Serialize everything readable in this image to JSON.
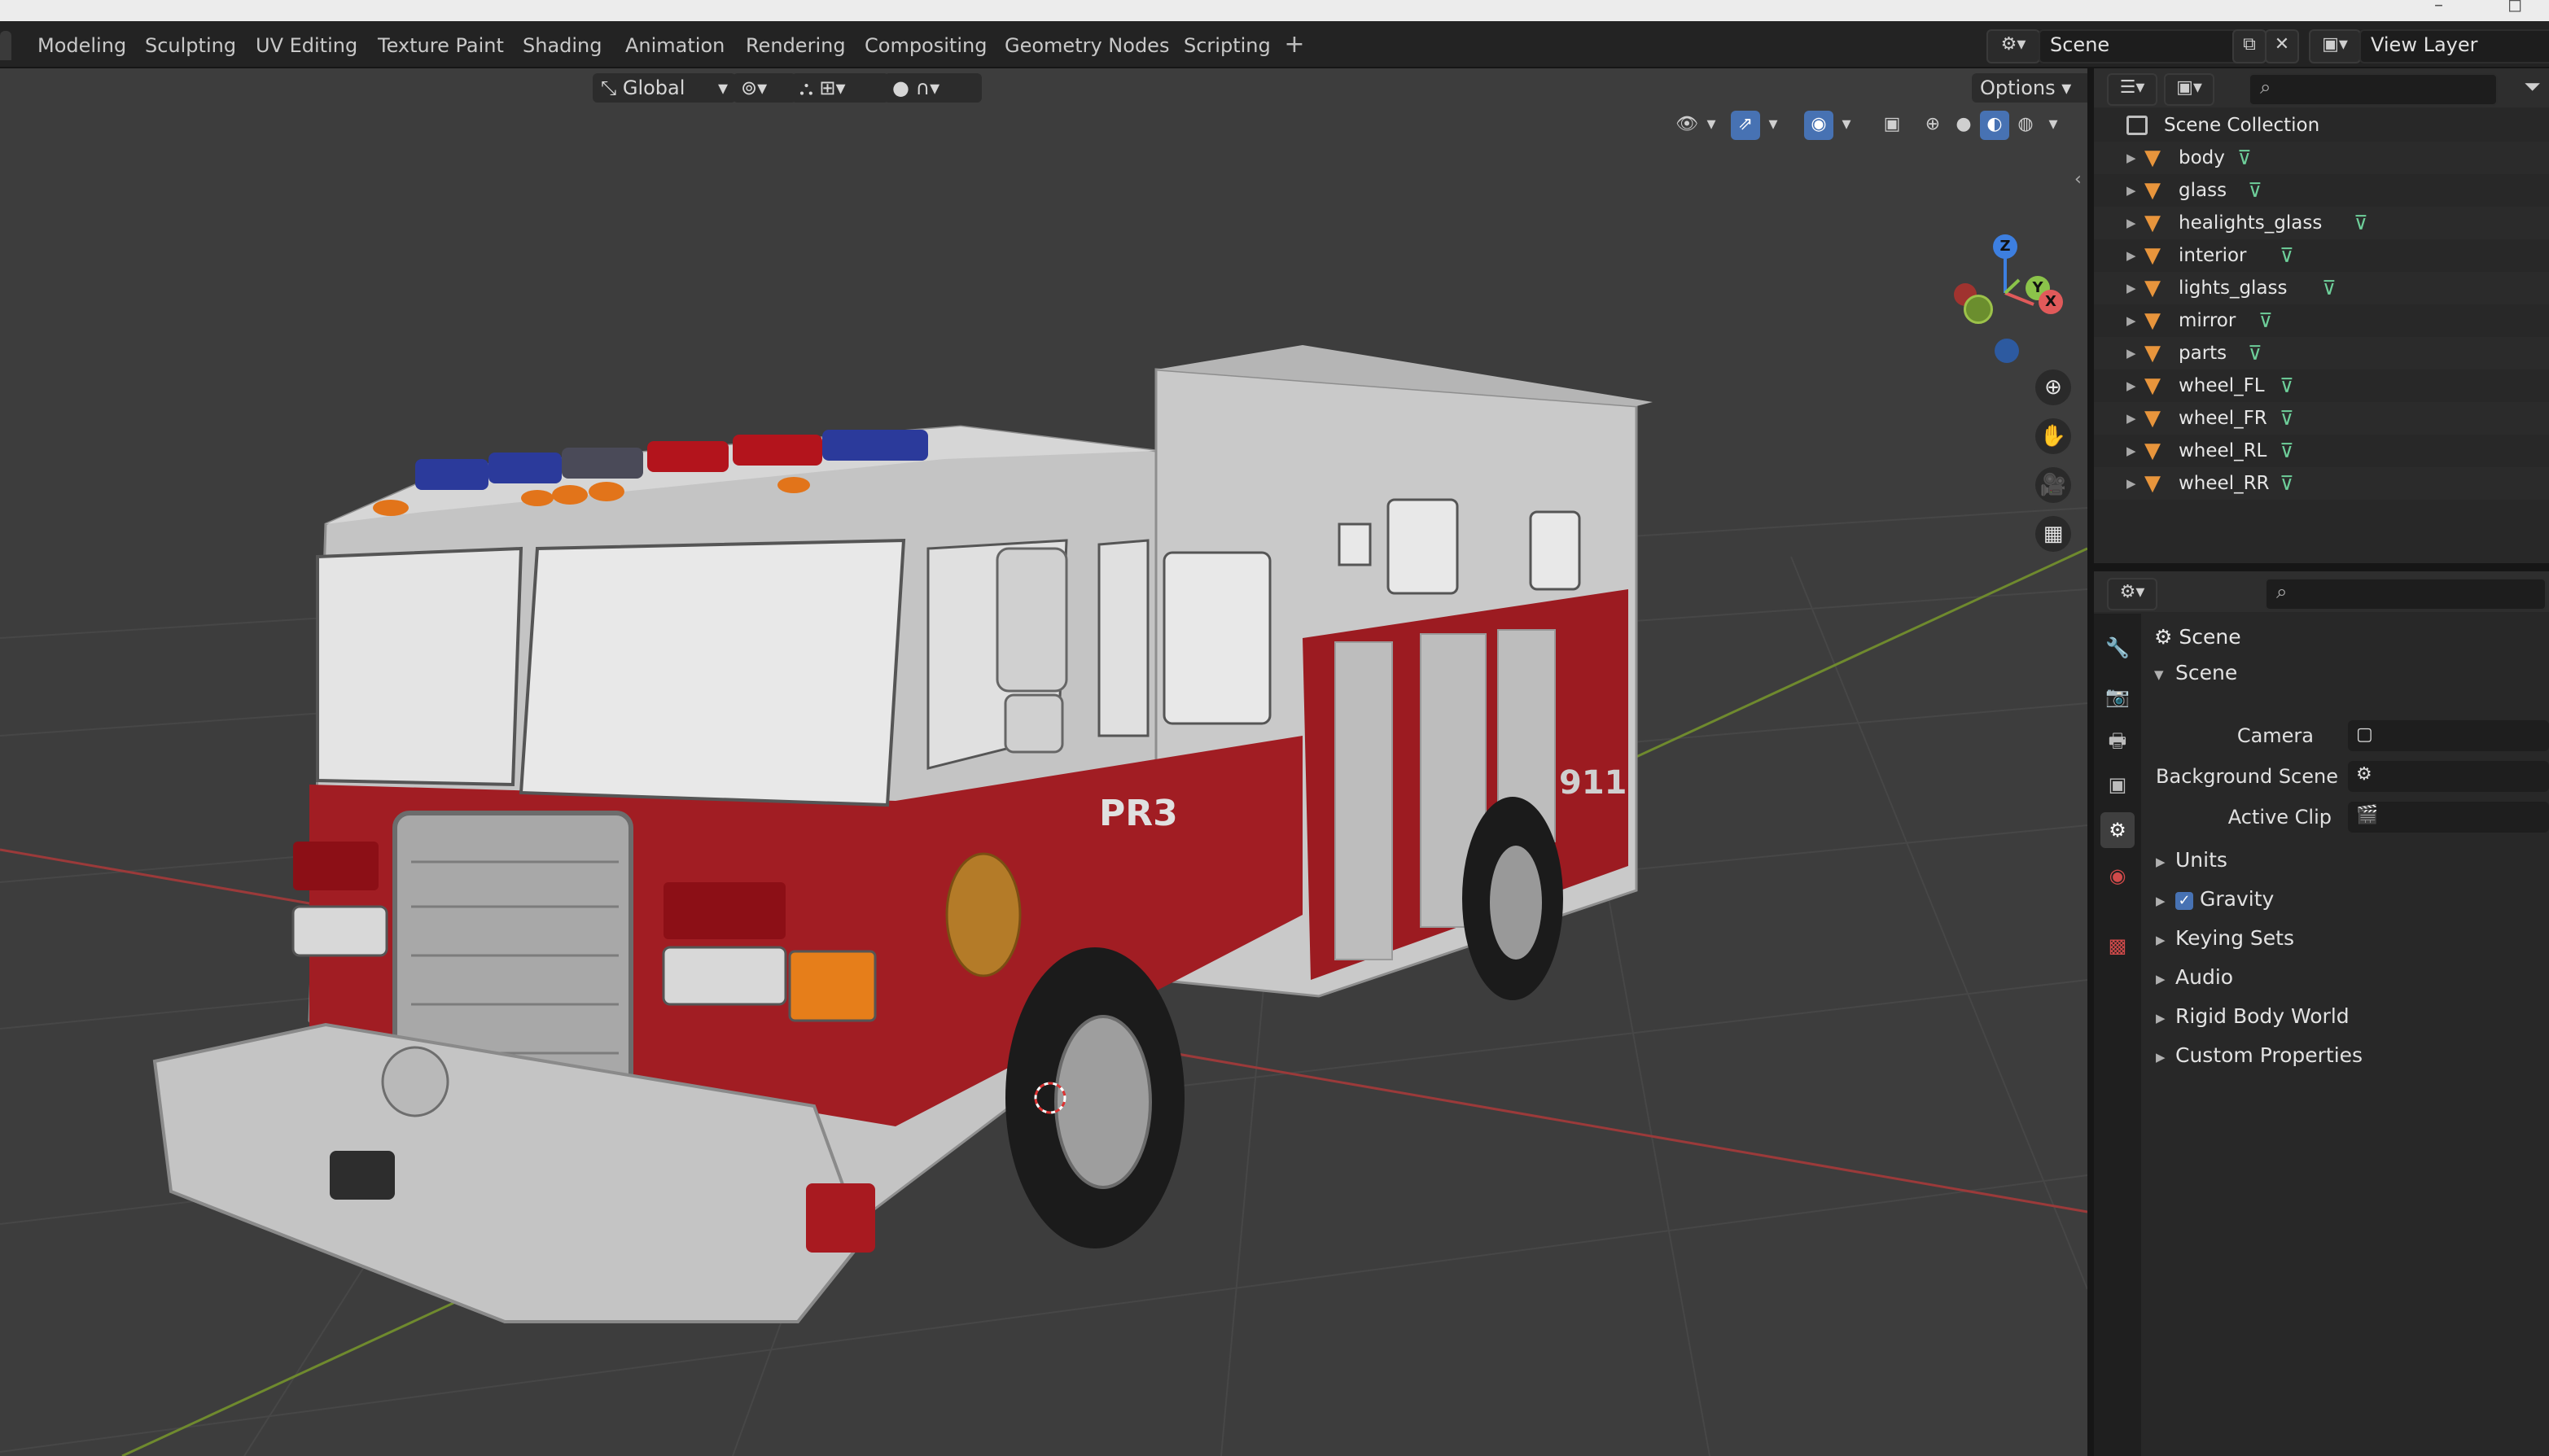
{
  "workspace_tabs": [
    "Modeling",
    "Sculpting",
    "UV Editing",
    "Texture Paint",
    "Shading",
    "Animation",
    "Rendering",
    "Compositing",
    "Geometry Nodes",
    "Scripting"
  ],
  "scene_selector": "Scene",
  "view_layer": "View Layer",
  "viewport": {
    "transform_orientation": "Global",
    "options_label": "Options",
    "gizmo_axes": {
      "x": "X",
      "y": "Y",
      "z": "Z"
    },
    "truck_labels": {
      "cab_number": "PR3",
      "side_number": "911"
    }
  },
  "outliner": {
    "root": "Scene Collection",
    "items": [
      {
        "name": "body"
      },
      {
        "name": "glass"
      },
      {
        "name": "healights_glass"
      },
      {
        "name": "interior"
      },
      {
        "name": "lights_glass"
      },
      {
        "name": "mirror"
      },
      {
        "name": "parts"
      },
      {
        "name": "wheel_FL"
      },
      {
        "name": "wheel_FR"
      },
      {
        "name": "wheel_RL"
      },
      {
        "name": "wheel_RR"
      }
    ]
  },
  "properties": {
    "context": "Scene",
    "panel_title": "Scene",
    "fields": [
      {
        "label": "Camera"
      },
      {
        "label": "Background Scene"
      },
      {
        "label": "Active Clip"
      }
    ],
    "subpanels": [
      "Units",
      "Gravity",
      "Keying Sets",
      "Audio",
      "Rigid Body World",
      "Custom Properties"
    ],
    "gravity_checked": true
  },
  "colors": {
    "accent": "#4772b3",
    "mesh_icon": "#e8953c",
    "mesh_data_icon": "#6ecf9a",
    "axis_x": "#e05a5a",
    "axis_y": "#8bc34a",
    "axis_z": "#3d7fe0"
  }
}
